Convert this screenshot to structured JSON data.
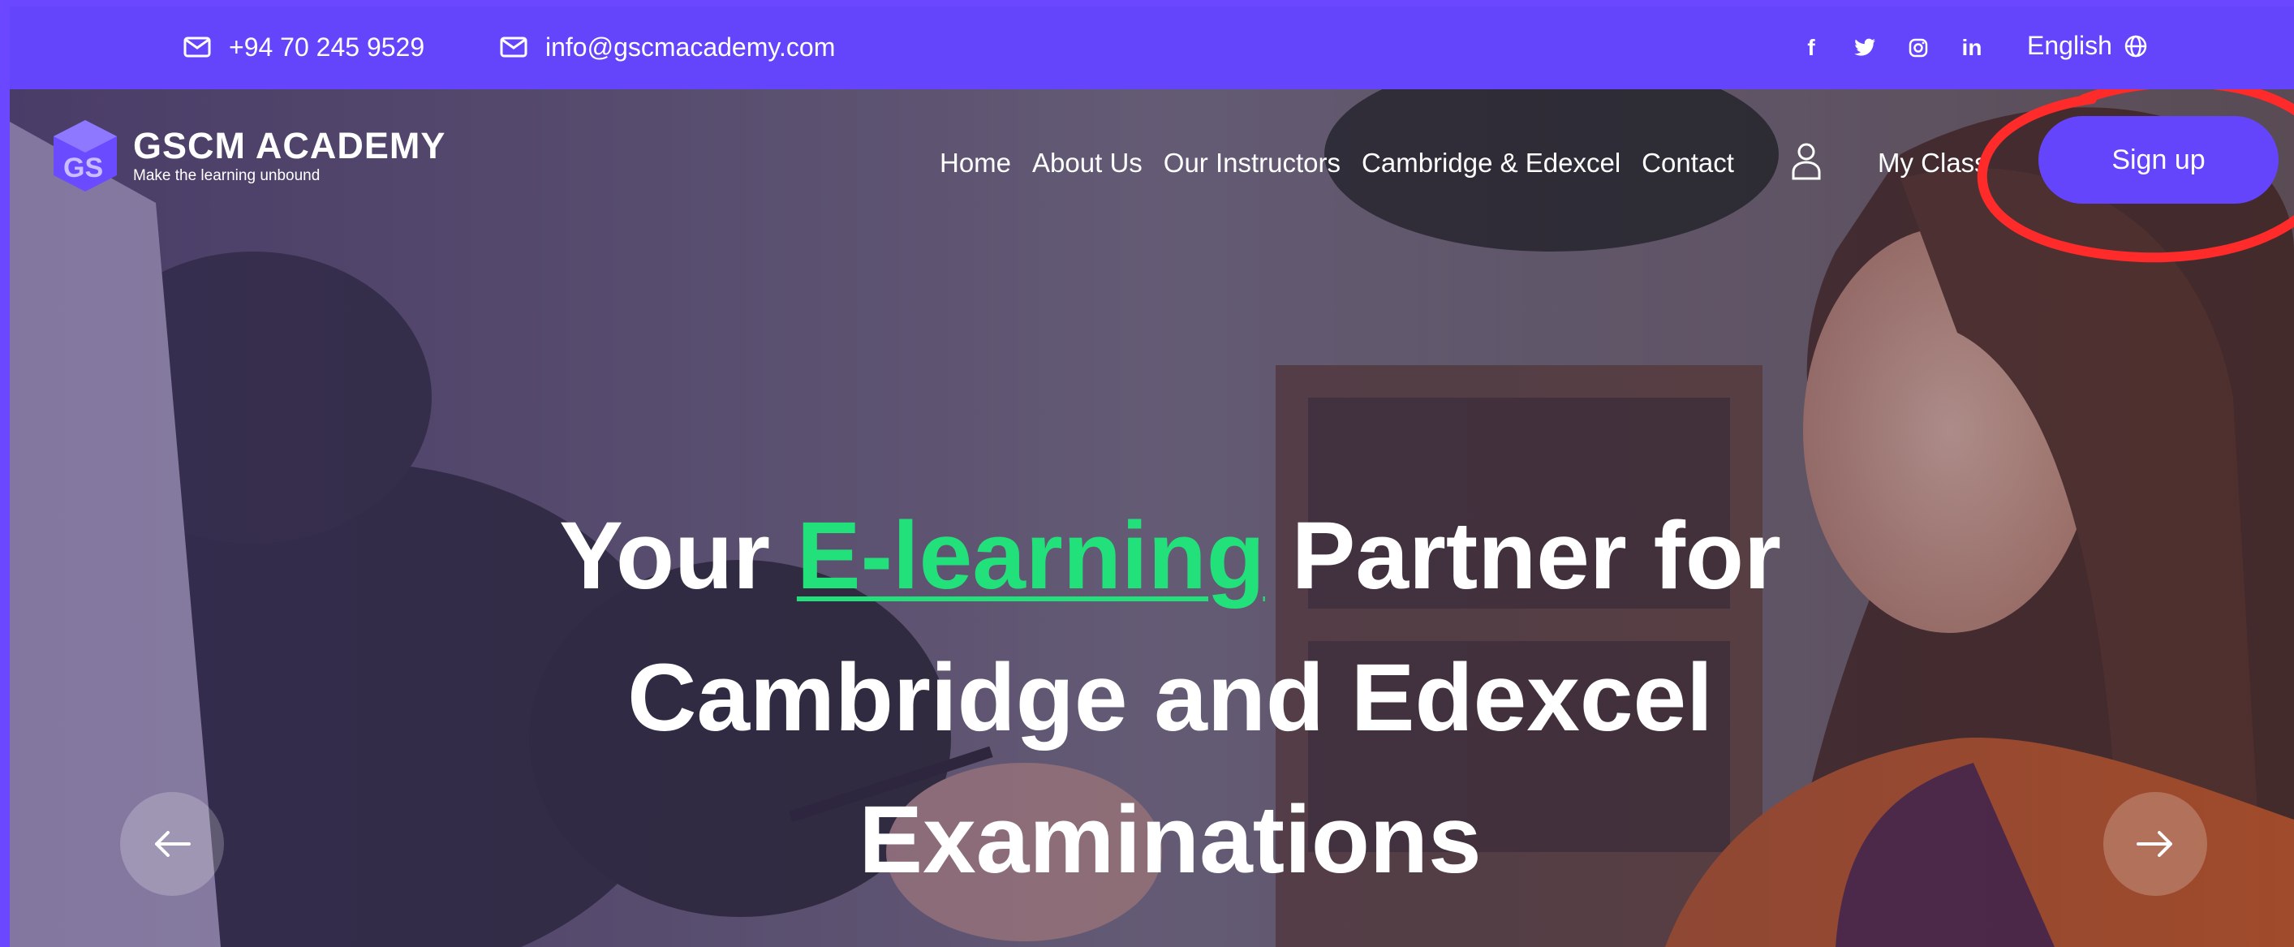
{
  "topbar": {
    "phone": "+94 70 245 9529",
    "email": "info@gscmacademy.com",
    "socials": [
      {
        "icon": "facebook-icon",
        "glyph": "f"
      },
      {
        "icon": "twitter-icon",
        "glyph": "🐦"
      },
      {
        "icon": "instagram-icon",
        "glyph": "◎"
      },
      {
        "icon": "linkedin-icon",
        "glyph": "in"
      }
    ],
    "language": "English"
  },
  "brand": {
    "name": "GSCM ACADEMY",
    "tagline": "Make the learning unbound"
  },
  "nav": {
    "items": [
      "Home",
      "About Us",
      "Our Instructors",
      "Cambridge & Edexcel",
      "Contact"
    ],
    "my_class": "My Class",
    "signup": "Sign up"
  },
  "hero": {
    "headline_before": "Your ",
    "headline_accent": "E-learning",
    "headline_after": " Partner for Cambridge and Edexcel Examinations"
  },
  "colors": {
    "brand": "#6445fb",
    "accent": "#22e07a",
    "annotation": "#ff2a2a"
  }
}
